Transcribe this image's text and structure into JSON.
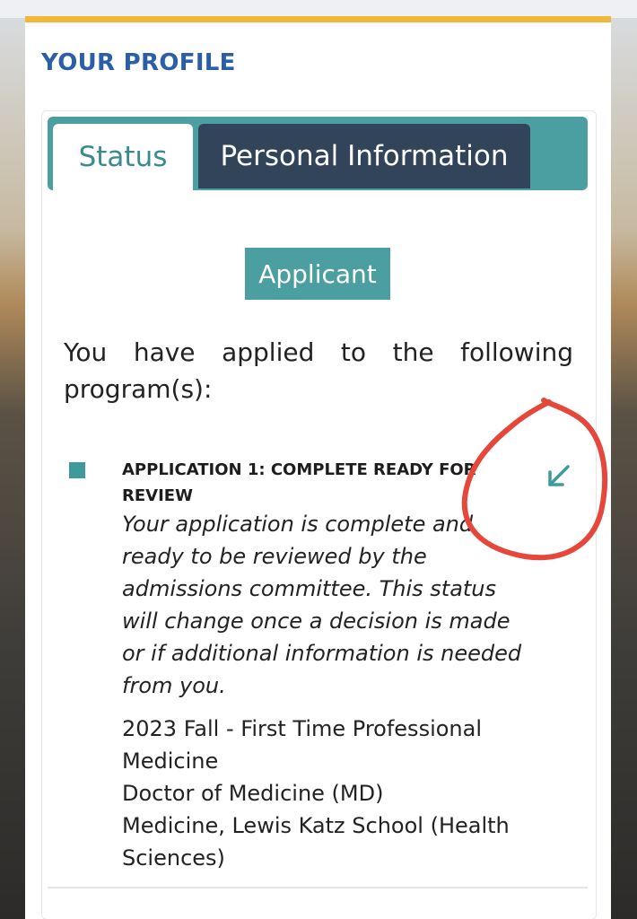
{
  "profile": {
    "title": "YOUR PROFILE"
  },
  "tabs": [
    {
      "label": "Status",
      "active": true
    },
    {
      "label": "Personal Information",
      "active": false
    }
  ],
  "status": {
    "badge": "Applicant",
    "intro": "You have applied to the following program(s):",
    "applications": [
      {
        "heading": "APPLICATION 1: COMPLETE READY FOR REVIEW",
        "description": "Your application is complete and ready to be reviewed by the admissions committee. This status will change once a decision is made or if additional information is needed from you.",
        "program_lines": [
          "2023 Fall - First Time Professional Medicine",
          "Doctor of Medicine (MD)",
          "Medicine, Lewis Katz School (Health Sciences)"
        ],
        "expand_icon": "arrow-down-left-icon"
      }
    ]
  },
  "colors": {
    "accent_border": "#f2b63b",
    "title_blue": "#2a5fa8",
    "teal": "#4b9fa0",
    "navy_tab": "#324459",
    "annotation_red": "#e5473b"
  }
}
